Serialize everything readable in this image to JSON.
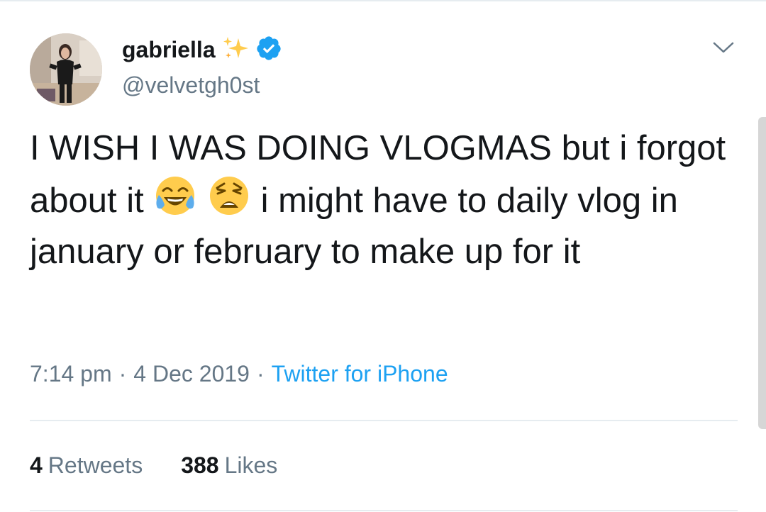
{
  "tweet": {
    "author": {
      "display_name": "gabriella",
      "handle": "@velvetgh0st",
      "verified": true,
      "name_emoji_icon": "sparkles-icon"
    },
    "text_before_emoji": "I WISH I WAS DOING VLOGMAS but i forgot about it",
    "emojis": [
      "face-with-tears-of-joy-icon",
      "weary-face-icon"
    ],
    "text_after_emoji": "i might have to daily vlog in january or february to make up for it",
    "time": "7:14 pm",
    "date": "4 Dec 2019",
    "separator": "·",
    "source": "Twitter for iPhone",
    "stats": {
      "retweets_count": "4",
      "retweets_label": "Retweets",
      "likes_count": "388",
      "likes_label": "Likes"
    }
  },
  "colors": {
    "text_primary": "#14171a",
    "text_secondary": "#657786",
    "link_blue": "#1da1f2",
    "divider": "#e6ecf0"
  }
}
